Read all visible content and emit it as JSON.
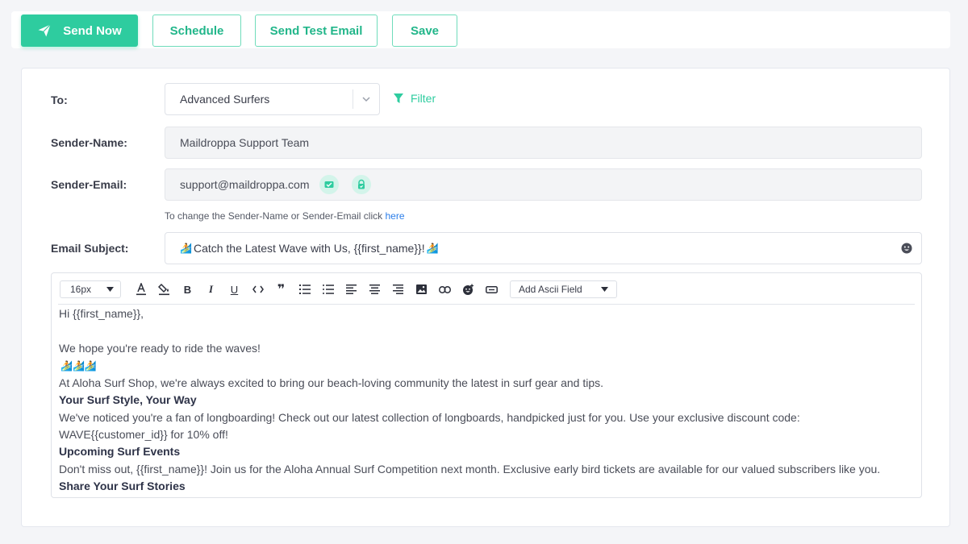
{
  "toolbar": {
    "send_now": "Send Now",
    "schedule": "Schedule",
    "send_test": "Send Test Email",
    "save": "Save"
  },
  "form": {
    "to_label": "To:",
    "to_value": "Advanced Surfers",
    "filter_label": "Filter",
    "sender_name_label": "Sender-Name:",
    "sender_name_value": "Maildroppa Support Team",
    "sender_email_label": "Sender-Email:",
    "sender_email_value": "support@maildroppa.com",
    "hint_text": "To change the Sender-Name or Sender-Email click ",
    "hint_link": "here",
    "subject_label": "Email Subject:",
    "subject_value": "Catch the Latest Wave with Us, {{first_name}}!"
  },
  "editor": {
    "font_size": "16px",
    "ascii_field": "Add Ascii Field",
    "lines": [
      {
        "text": "Hi {{first_name}},",
        "bold": false
      },
      {
        "text": "",
        "bold": false
      },
      {
        "text": "We hope you're ready to ride the waves!",
        "bold": false
      },
      {
        "text": "",
        "bold": false,
        "surfers": true
      },
      {
        "text": "At Aloha Surf Shop, we're always excited to bring our beach-loving community the latest in surf gear and tips.",
        "bold": false
      },
      {
        "text": "Your Surf Style, Your Way",
        "bold": true
      },
      {
        "text": "We've noticed you're a fan of longboarding! Check out our latest collection of longboards, handpicked just for you. Use your exclusive discount code:",
        "bold": false
      },
      {
        "text": "WAVE{{customer_id}} for 10% off!",
        "bold": false
      },
      {
        "text": "Upcoming Surf Events",
        "bold": true
      },
      {
        "text": "Don't miss out, {{first_name}}! Join us for the Aloha Annual Surf Competition next month. Exclusive early bird tickets are available for our valued subscribers like you.",
        "bold": false
      },
      {
        "text": "Share Your Surf Stories",
        "bold": true
      }
    ]
  },
  "colors": {
    "accent": "#2ecc9f",
    "link": "#2b7de9"
  }
}
